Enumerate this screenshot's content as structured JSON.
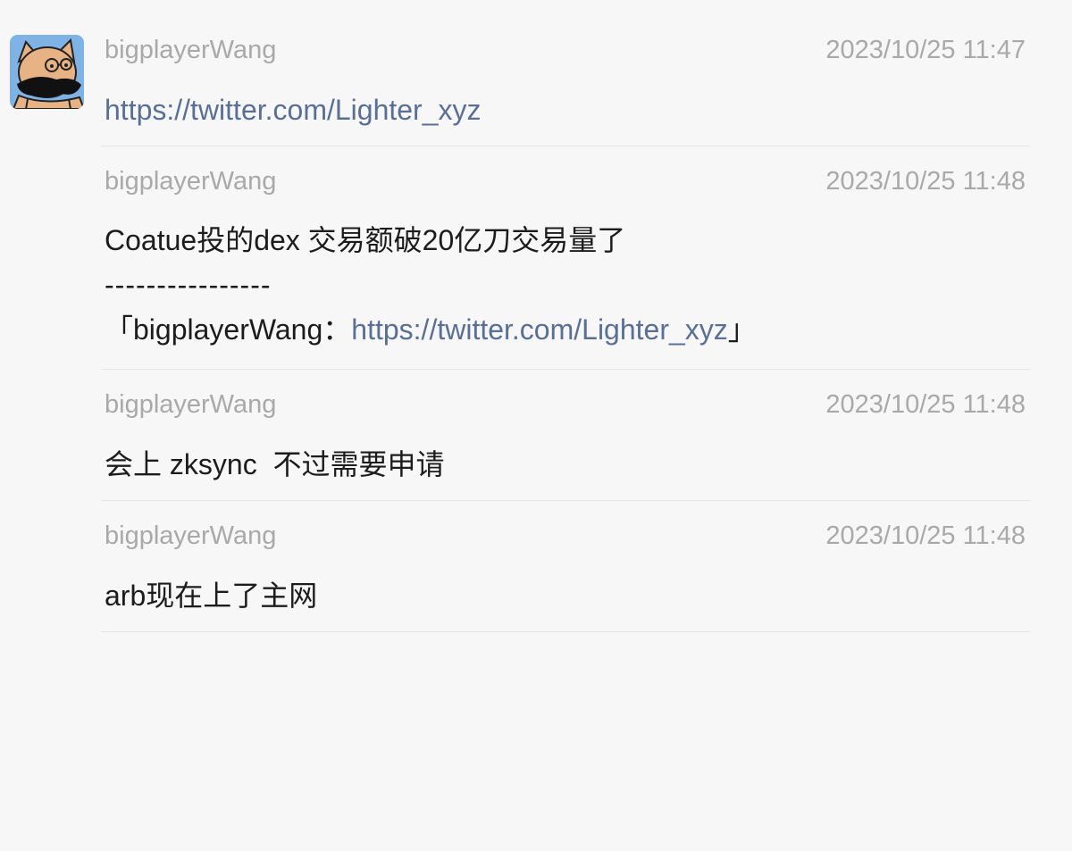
{
  "messages": [
    {
      "sender": "bigplayerWang",
      "time": "2023/10/25 11:47",
      "link": "https://twitter.com/Lighter_xyz"
    },
    {
      "sender": "bigplayerWang",
      "time": "2023/10/25 11:48",
      "text": "Coatue投的dex 交易额破20亿刀交易量了",
      "divider": "----------------",
      "quote_open": "「bigplayerWang：",
      "quote_link": "https://twitter.com/Lighter_xyz",
      "quote_close": "」"
    },
    {
      "sender": "bigplayerWang",
      "time": "2023/10/25 11:48",
      "text": "会上 zksync  不过需要申请"
    },
    {
      "sender": "bigplayerWang",
      "time": "2023/10/25 11:48",
      "text": "arb现在上了主网"
    }
  ],
  "colors": {
    "background": "#f7f7f7",
    "meta": "#a9a9a9",
    "text": "#1c1c1c",
    "link": "#5a6f96",
    "separator": "#e4e4e4"
  },
  "avatar_icon": "cartoon-cat-avatar-icon"
}
